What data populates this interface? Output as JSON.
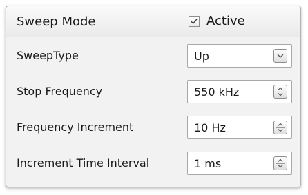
{
  "panel": {
    "title": "Sweep Mode",
    "active": {
      "label": "Active",
      "checked": true,
      "icon": "check-icon"
    }
  },
  "rows": [
    {
      "label": "SweepType",
      "value": "Up",
      "control": "dropdown",
      "icon": "chevron-down-icon"
    },
    {
      "label": "Stop Frequency",
      "value": "550 kHz",
      "control": "spinner",
      "icon": "spinner-arrows-icon"
    },
    {
      "label": "Frequency Increment",
      "value": "10 Hz",
      "control": "spinner",
      "icon": "spinner-arrows-icon"
    },
    {
      "label": "Increment Time Interval",
      "value": "1 ms",
      "control": "spinner",
      "icon": "spinner-arrows-icon"
    }
  ]
}
